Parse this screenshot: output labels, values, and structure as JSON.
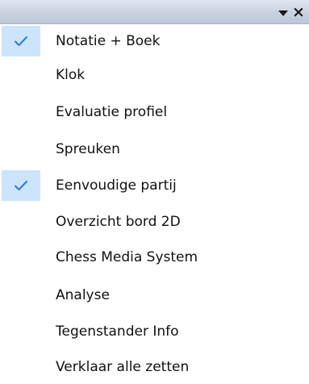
{
  "titlebar": {
    "dropdown_icon": "dropdown-arrow-icon",
    "close_label": "×"
  },
  "menu": {
    "items": [
      {
        "label": "Notatie + Boek",
        "checked": true
      },
      {
        "label": "Klok",
        "checked": false
      },
      {
        "label": "Evaluatie profiel",
        "checked": false
      },
      {
        "label": "Spreuken",
        "checked": false
      },
      {
        "label": "Eenvoudige partij",
        "checked": true
      },
      {
        "label": "Overzicht bord 2D",
        "checked": false
      },
      {
        "label": "Chess Media System",
        "checked": false
      },
      {
        "label": "Analyse",
        "checked": false
      },
      {
        "label": "Tegenstander Info",
        "checked": false
      },
      {
        "label": "Verklaar alle zetten",
        "checked": false
      }
    ]
  },
  "colors": {
    "check_highlight": "#cce5fa",
    "check_mark": "#2b7cd3",
    "titlebar": "#c8d2e0"
  }
}
